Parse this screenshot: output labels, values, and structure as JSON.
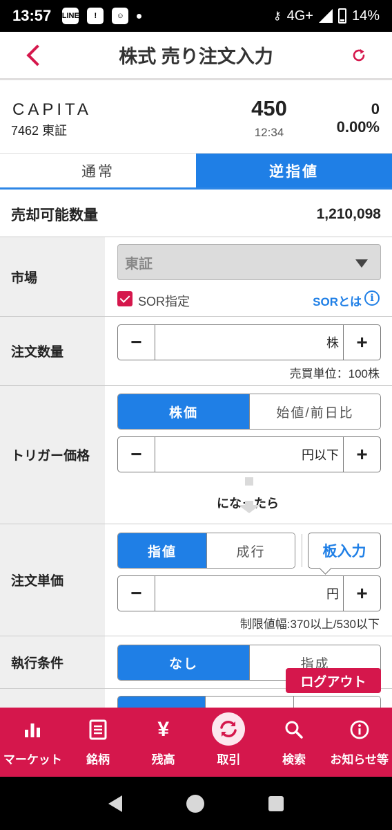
{
  "status_bar": {
    "time": "13:57",
    "notif_icons": [
      "line-icon",
      "alert-icon",
      "face-icon"
    ],
    "network": "4G+",
    "battery": "14%"
  },
  "header": {
    "title": "株式 売り注文入力"
  },
  "stock": {
    "name": "CAPITA",
    "code_market": "7462 東証",
    "price": "450",
    "price_time": "12:34",
    "change": "0",
    "change_percent": "0.00%"
  },
  "tabs": [
    {
      "label": "通常",
      "active": false
    },
    {
      "label": "逆指値",
      "active": true
    }
  ],
  "sellable": {
    "label": "売却可能数量",
    "value": "1,210,098"
  },
  "market": {
    "label": "市場",
    "selected": "東証",
    "sor_label": "SOR指定",
    "sor_checked": true,
    "sor_link": "SORとは"
  },
  "quantity": {
    "label": "注文数量",
    "value": "",
    "unit": "株",
    "note": "売買単位：100株"
  },
  "trigger": {
    "label": "トリガー価格",
    "options": [
      "株価",
      "始値/前日比"
    ],
    "selected": "株価",
    "unit": "円以下",
    "then_text": "になったら"
  },
  "order_price": {
    "label": "注文単価",
    "options": [
      "指値",
      "成行"
    ],
    "selected": "指値",
    "board_button": "板入力",
    "unit": "円",
    "note": "制限値幅:370以上/530以下"
  },
  "execution": {
    "label": "執行条件",
    "options": [
      "なし",
      "指成"
    ],
    "selected": "なし"
  },
  "buttons": {
    "minus": "−",
    "plus": "+",
    "logout": "ログアウト"
  },
  "bottom_nav": [
    {
      "label": "マーケット",
      "icon": "bar-chart-icon",
      "active": false
    },
    {
      "label": "銘柄",
      "icon": "document-icon",
      "active": false
    },
    {
      "label": "残高",
      "icon": "yen-icon",
      "active": false
    },
    {
      "label": "取引",
      "icon": "refresh-cycle-icon",
      "active": true
    },
    {
      "label": "検索",
      "icon": "search-icon",
      "active": false
    },
    {
      "label": "お知らせ等",
      "icon": "info-icon",
      "active": false
    }
  ],
  "colors": {
    "accent_red": "#d5174c",
    "accent_blue": "#1f7fe6",
    "label_bg": "#efefef"
  }
}
